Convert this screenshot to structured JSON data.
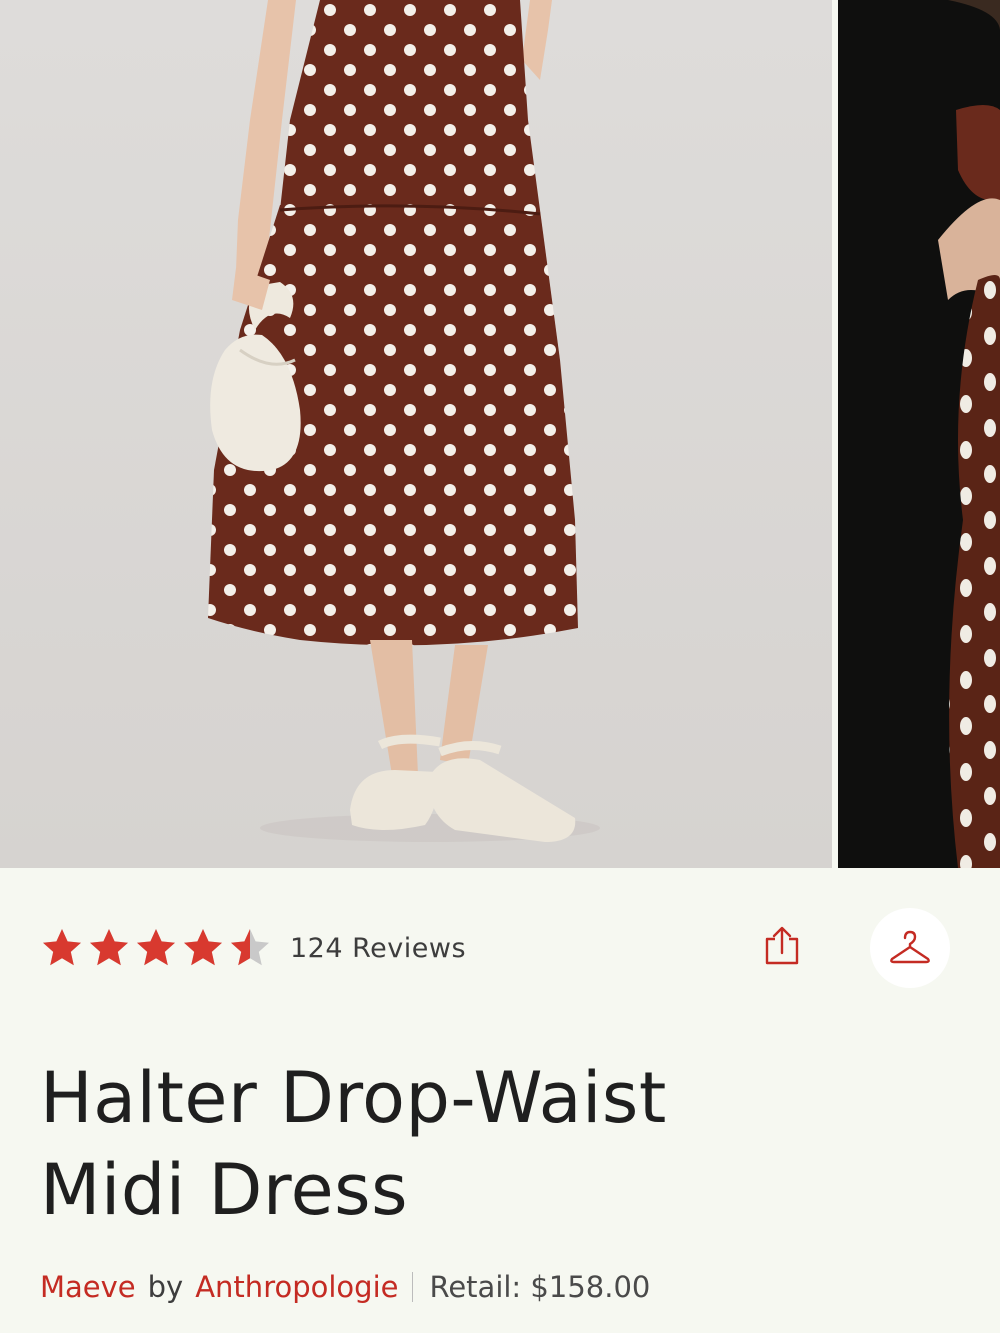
{
  "product": {
    "title_line1": "Halter Drop-Waist",
    "title_line2": "Midi Dress",
    "brand": "Maeve",
    "by": "by",
    "store": "Anthropologie",
    "retail": "Retail: $158.00"
  },
  "rating": {
    "value": 4.5,
    "max": 5,
    "reviews_label": "124 Reviews"
  },
  "colors": {
    "accent": "#c42b23",
    "star_filled": "#d8392f",
    "star_empty": "#c9c9c9",
    "dress": "#6a2a1c",
    "background": "#f6f8f1"
  },
  "icons": {
    "share": "share-icon",
    "wishlist": "hanger-icon"
  }
}
